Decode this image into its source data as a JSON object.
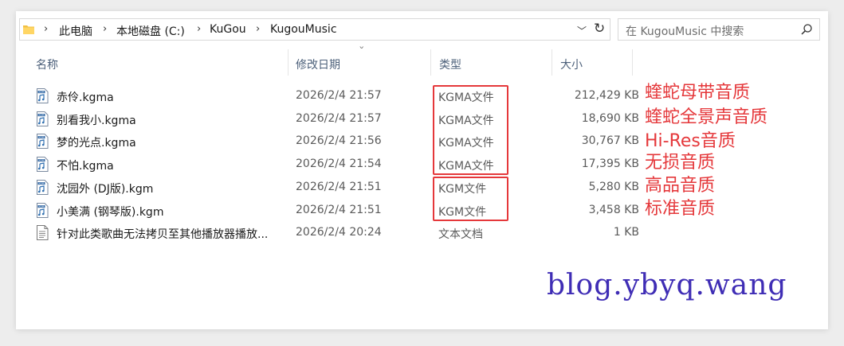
{
  "address_bar": {
    "crumbs": [
      "此电脑",
      "本地磁盘 (C:)",
      "KuGou",
      "KugouMusic"
    ],
    "dropdown_glyph": "﹀",
    "refresh_glyph": "↻"
  },
  "search": {
    "placeholder": "在 KugouMusic 中搜索"
  },
  "columns": {
    "name": "名称",
    "date": "修改日期",
    "type": "类型",
    "size": "大小"
  },
  "files": [
    {
      "name": "赤伶.kgma",
      "date": "2026/2/4 21:57",
      "type": "KGMA文件",
      "size": "212,429 KB",
      "icon": "kgm-audio-icon"
    },
    {
      "name": "别看我小.kgma",
      "date": "2026/2/4 21:57",
      "type": "KGMA文件",
      "size": "18,690 KB",
      "icon": "kgm-audio-icon"
    },
    {
      "name": "梦的光点.kgma",
      "date": "2026/2/4 21:56",
      "type": "KGMA文件",
      "size": "30,767 KB",
      "icon": "kgm-audio-icon"
    },
    {
      "name": "不怕.kgma",
      "date": "2026/2/4 21:54",
      "type": "KGMA文件",
      "size": "17,395 KB",
      "icon": "kgm-audio-icon"
    },
    {
      "name": "沈园外 (DJ版).kgm",
      "date": "2026/2/4 21:51",
      "type": "KGM文件",
      "size": "5,280 KB",
      "icon": "kgm-audio-icon"
    },
    {
      "name": "小美满 (钢琴版).kgm",
      "date": "2026/2/4 21:51",
      "type": "KGM文件",
      "size": "3,458 KB",
      "icon": "kgm-audio-icon"
    },
    {
      "name": "针对此类歌曲无法拷贝至其他播放器播放...",
      "date": "2026/2/4 20:24",
      "type": "文本文档",
      "size": "1 KB",
      "icon": "text-document-icon"
    }
  ],
  "annotations": {
    "quality_labels": [
      "蝰蛇母带音质",
      "蝰蛇全景声音质",
      "Hi-Res音质",
      "无损音质",
      "高品音质",
      "标准音质"
    ],
    "color": "#e5383b"
  },
  "watermark": "blog.ybyq.wang",
  "colors": {
    "header_text": "#4c607a",
    "watermark": "#3f2db5",
    "annotation_red": "#e5383b"
  }
}
